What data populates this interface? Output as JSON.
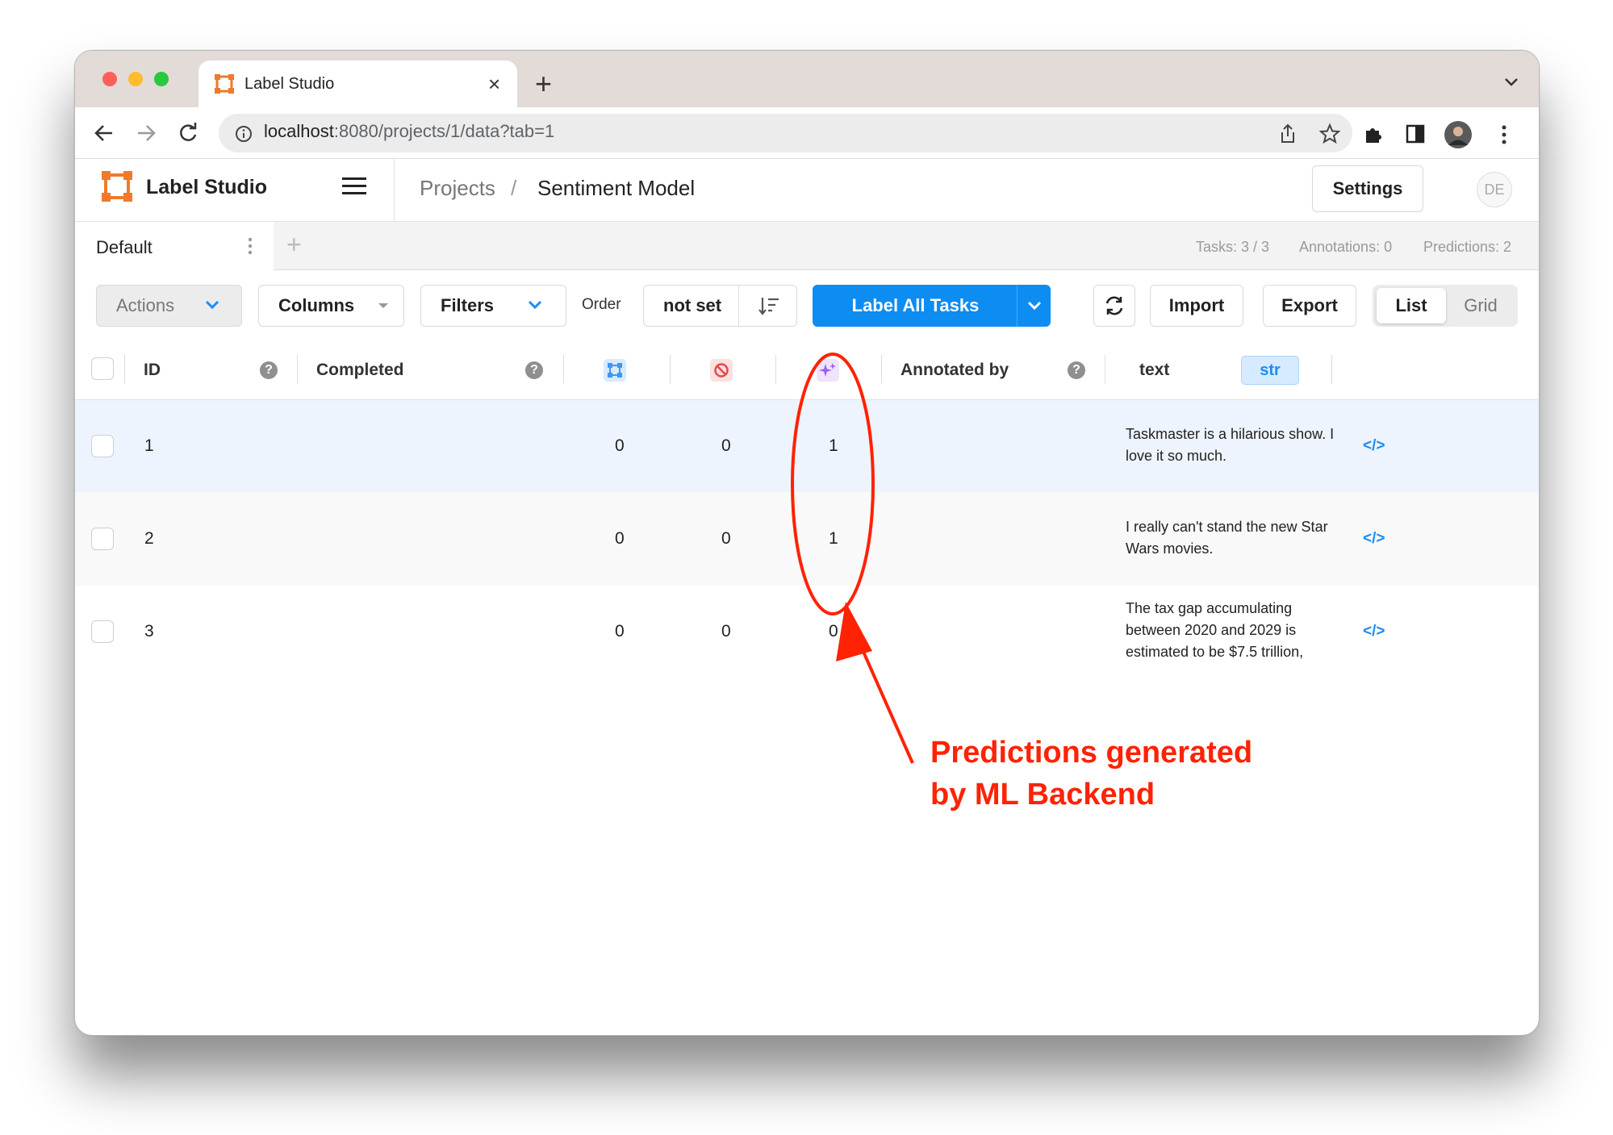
{
  "browser": {
    "tab_title": "Label Studio",
    "tab_close": "×",
    "new_tab": "+",
    "url_host": "localhost",
    "url_rest": ":8080/projects/1/data?tab=1"
  },
  "header": {
    "app_name": "Label Studio",
    "breadcrumb": [
      "Projects",
      "Sentiment Model"
    ],
    "breadcrumb_sep": "/",
    "settings_label": "Settings",
    "avatar_initials": "DE"
  },
  "tabs": {
    "active": "Default",
    "add": "+"
  },
  "stats": {
    "tasks": "Tasks: 3 / 3",
    "annotations": "Annotations: 0",
    "predictions": "Predictions: 2"
  },
  "toolbar": {
    "actions": "Actions",
    "columns": "Columns",
    "filters": "Filters",
    "order_label": "Order",
    "order_value": "not set",
    "label_all": "Label All Tasks",
    "import": "Import",
    "export": "Export",
    "view_list": "List",
    "view_grid": "Grid"
  },
  "table": {
    "headers": {
      "id": "ID",
      "completed": "Completed",
      "annotated_by": "Annotated by",
      "text": "text",
      "text_type": "str"
    },
    "help_glyph": "?",
    "code_glyph": "</>",
    "rows": [
      {
        "id": "1",
        "annotations": "0",
        "cancelled": "0",
        "predictions": "1",
        "text": "Taskmaster is a hilarious show. I love it so much."
      },
      {
        "id": "2",
        "annotations": "0",
        "cancelled": "0",
        "predictions": "1",
        "text": "I really can't stand the new Star Wars movies."
      },
      {
        "id": "3",
        "annotations": "0",
        "cancelled": "0",
        "predictions": "0",
        "text": "The tax gap accumulating between 2020 and 2029 is estimated to be $7.5 trillion,"
      }
    ]
  },
  "annotation": {
    "line1": "Predictions generated",
    "line2": "by ML Backend",
    "color": "#ff2205"
  },
  "colors": {
    "accent": "#0d8cf2",
    "brand": "#f07a2a",
    "row_selected": "#eef4fd",
    "row_alt": "#f9f9f9"
  }
}
